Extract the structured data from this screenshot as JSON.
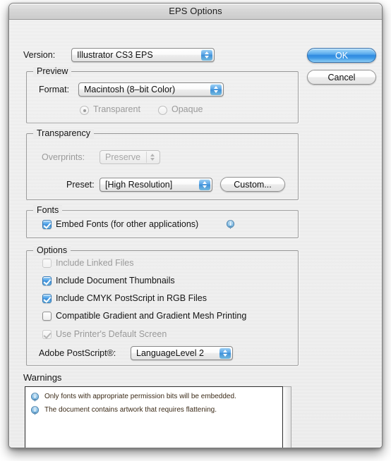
{
  "window": {
    "title": "EPS Options"
  },
  "buttons": {
    "ok": "OK",
    "cancel": "Cancel",
    "custom": "Custom..."
  },
  "version": {
    "label": "Version:",
    "value": "Illustrator CS3 EPS"
  },
  "preview": {
    "title": "Preview",
    "format_label": "Format:",
    "format_value": "Macintosh (8–bit Color)",
    "transparent_label": "Transparent",
    "opaque_label": "Opaque"
  },
  "transparency": {
    "title": "Transparency",
    "overprints_label": "Overprints:",
    "overprints_value": "Preserve",
    "preset_label": "Preset:",
    "preset_value": "[High Resolution]"
  },
  "fonts": {
    "title": "Fonts",
    "embed_label": "Embed Fonts (for other applications)"
  },
  "options": {
    "title": "Options",
    "items": [
      "Include Linked Files",
      "Include Document Thumbnails",
      "Include CMYK PostScript in RGB Files",
      "Compatible Gradient and Gradient Mesh Printing",
      "Use Printer's Default Screen"
    ],
    "postscript_label": "Adobe PostScript®:",
    "postscript_value": "LanguageLevel 2"
  },
  "warnings": {
    "title": "Warnings",
    "messages": [
      "Only fonts with appropriate permission bits will be embedded.",
      "The document contains artwork that requires flattening."
    ]
  },
  "colors": {
    "accent_blue": "#3a8ad6",
    "window_bg": "#ededed",
    "disabled_text": "#9a9a9a"
  }
}
